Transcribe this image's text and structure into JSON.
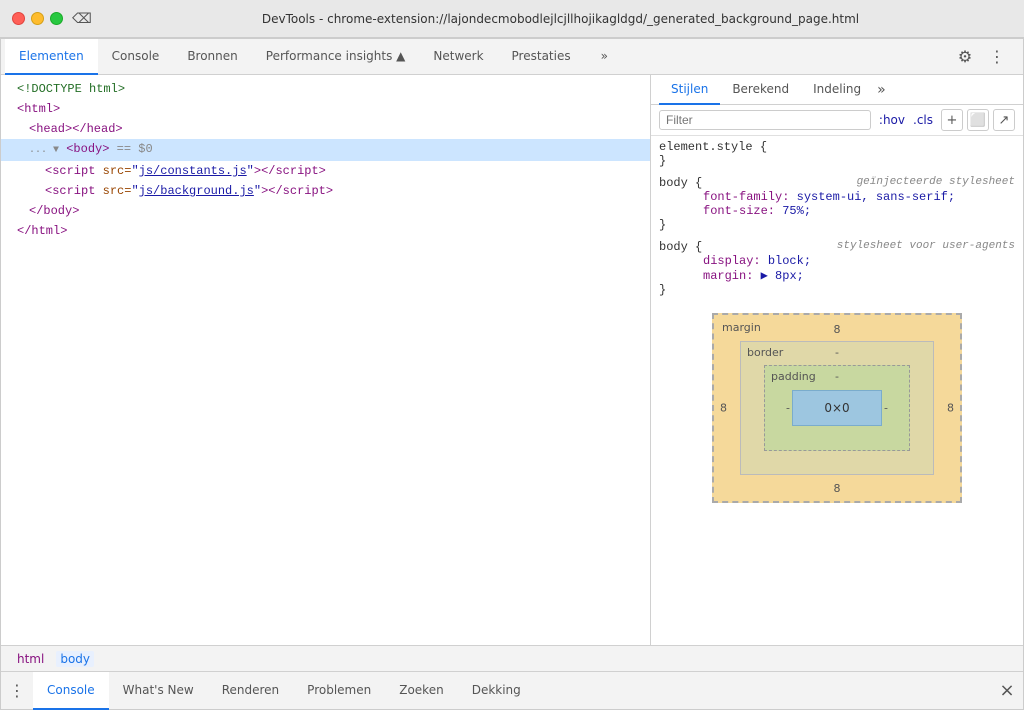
{
  "titlebar": {
    "title": "DevTools - chrome-extension://lajondecmobodlejlcjllhojikagldgd/_generated_background_page.html"
  },
  "tabs": [
    {
      "id": "elementen",
      "label": "Elementen",
      "active": true
    },
    {
      "id": "console",
      "label": "Console",
      "active": false
    },
    {
      "id": "bronnen",
      "label": "Bronnen",
      "active": false
    },
    {
      "id": "performance",
      "label": "Performance insights ▲",
      "active": false
    },
    {
      "id": "netwerk",
      "label": "Netwerk",
      "active": false
    },
    {
      "id": "prestaties",
      "label": "Prestaties",
      "active": false
    }
  ],
  "tabs_more_label": "»",
  "dom": {
    "lines": [
      {
        "indent": 0,
        "content": "<!DOCTYPE html>",
        "type": "comment"
      },
      {
        "indent": 0,
        "content_html": "<span class='tag'>&lt;html&gt;</span>",
        "type": "tag"
      },
      {
        "indent": 1,
        "content_html": "<span class='tag'>&lt;head&gt;&lt;/head&gt;</span>",
        "type": "tag"
      },
      {
        "indent": 1,
        "content_html": "<span class='expand-arrow'>▼</span> <span class='tag'>&lt;body&gt;</span> <span class='equals-dollar'>== $0</span>",
        "type": "selected"
      },
      {
        "indent": 2,
        "content_html": "<span class='tag'>&lt;script</span> <span class='attr-name'>src=</span><span class='attr-value'>\"<span class='js-link'>js/constants.js</span>\"</span><span class='tag'>&gt;&lt;/script&gt;</span>",
        "type": "tag"
      },
      {
        "indent": 2,
        "content_html": "<span class='tag'>&lt;script</span> <span class='attr-name'>src=</span><span class='attr-value'>\"<span class='js-link'>js/background.js</span>\"</span><span class='tag'>&gt;&lt;/script&gt;</span>",
        "type": "tag"
      },
      {
        "indent": 1,
        "content_html": "<span class='tag'>&lt;/body&gt;</span>",
        "type": "tag"
      },
      {
        "indent": 0,
        "content_html": "<span class='tag'>&lt;/html&gt;</span>",
        "type": "tag"
      }
    ]
  },
  "styles": {
    "tabs": [
      "Stijlen",
      "Berekend",
      "Indeling"
    ],
    "active_tab": "Stijlen",
    "filter_placeholder": "Filter",
    "filter_pseudo": ":hov",
    "filter_cls": ".cls",
    "blocks": [
      {
        "selector": "element.style {",
        "source": "",
        "properties": [],
        "closing": "}"
      },
      {
        "selector": "body {",
        "source": "geïnjecteerde stylesheet",
        "properties": [
          {
            "name": "font-family:",
            "value": "system-ui, sans-serif;"
          },
          {
            "name": "font-size:",
            "value": "75%;"
          }
        ],
        "closing": "}"
      },
      {
        "selector": "body {",
        "source": "stylesheet voor user-agents",
        "properties": [
          {
            "name": "display:",
            "value": "block;"
          },
          {
            "name": "margin:",
            "value": "▶ 8px;"
          }
        ],
        "closing": "}"
      }
    ]
  },
  "box_model": {
    "margin_label": "margin",
    "margin_top": "8",
    "margin_bottom": "8",
    "margin_left": "8",
    "margin_right": "8",
    "border_label": "border",
    "border_val": "-",
    "padding_label": "padding",
    "padding_val": "-",
    "content_val": "0×0",
    "left_dash": "-",
    "right_dash": "-"
  },
  "breadcrumb": {
    "items": [
      "html",
      "body"
    ]
  },
  "bottom_tabs": [
    {
      "id": "console",
      "label": "Console",
      "active": true
    },
    {
      "id": "whats-new",
      "label": "What's New",
      "active": false
    },
    {
      "id": "renderen",
      "label": "Renderen",
      "active": false
    },
    {
      "id": "problemen",
      "label": "Problemen",
      "active": false
    },
    {
      "id": "zoeken",
      "label": "Zoeken",
      "active": false
    },
    {
      "id": "dekking",
      "label": "Dekking",
      "active": false
    }
  ]
}
